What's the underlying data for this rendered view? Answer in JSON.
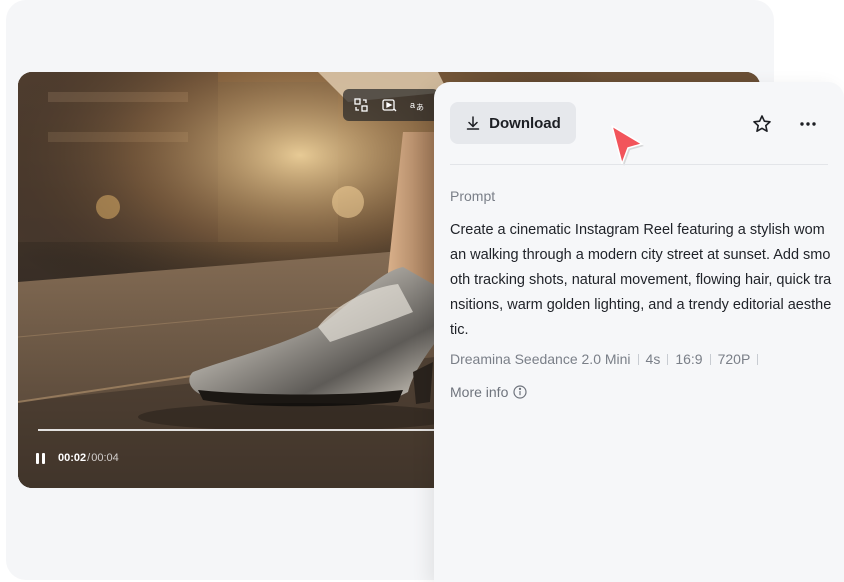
{
  "video": {
    "time_current": "00:02",
    "time_separator": "/",
    "time_total": "00:04",
    "progress": 0.5,
    "toolbar": [
      {
        "name": "replace-icon"
      },
      {
        "name": "video-enhance-icon"
      },
      {
        "name": "translate-icon"
      }
    ]
  },
  "panel": {
    "download_label": "Download",
    "prompt_label": "Prompt",
    "prompt_text": "Create a cinematic Instagram Reel featuring a stylish woman walking through a modern city street at sunset. Add smooth tracking shots, natural movement, flowing hair, quick transitions, warm golden lighting, and a trendy editorial aesthetic.",
    "meta": {
      "model": "Dreamina Seedance 2.0 Mini",
      "duration": "4s",
      "ratio": "16:9",
      "resolution": "720P"
    },
    "more_info_label": "More info"
  },
  "colors": {
    "cursor": "#f2545b",
    "panel_bg": "#f6f7f9",
    "download_bg": "#e6e8ec"
  }
}
